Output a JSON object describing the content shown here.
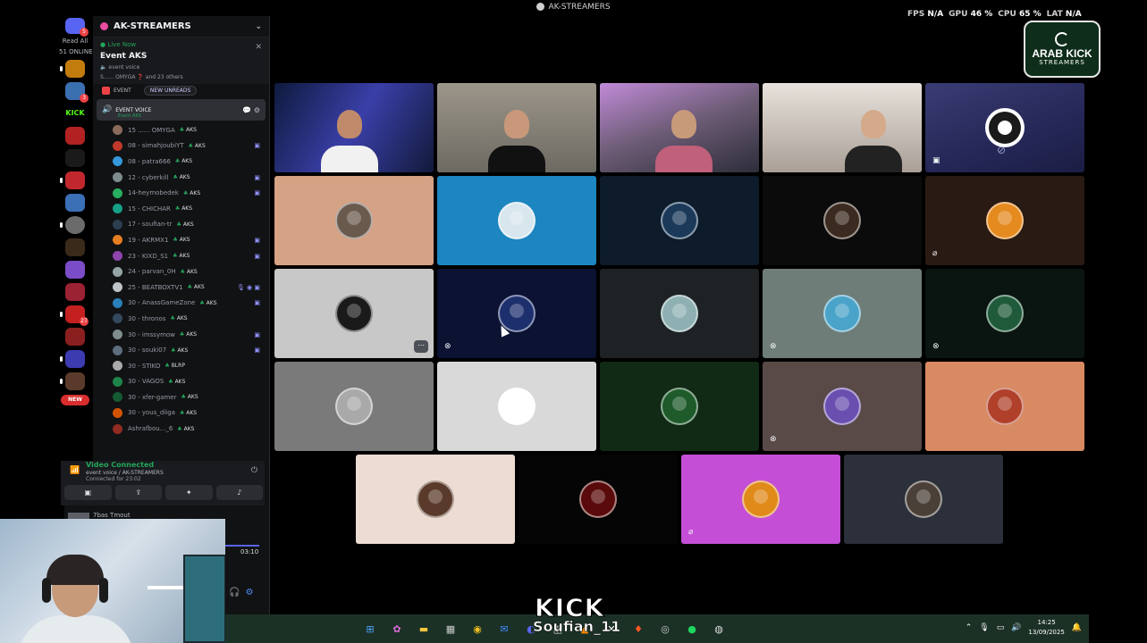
{
  "window_title": "AK-STREAMERS",
  "stats": {
    "fps_label": "FPS",
    "fps_value": "N/A",
    "gpu_label": "GPU",
    "gpu_value": "46 %",
    "cpu_label": "CPU",
    "cpu_value": "65 %",
    "lat_label": "LAT",
    "lat_value": "N/A"
  },
  "logo": {
    "line1": "ARAB KICK",
    "line2": "STREAMERS"
  },
  "rail": {
    "discord_badge": "5",
    "read_all": "Read All",
    "online": "51 ONLINE",
    "kick_label": "KICK",
    "badge_3": "3",
    "badge_27": "27",
    "new_label": "NEW"
  },
  "sidebar": {
    "server_name": "AK-STREAMERS",
    "event": {
      "live_label": "● Live Now",
      "name": "Event AKS",
      "voice": "event voice",
      "meta": "S...... OMYGA ❓ and 23 others"
    },
    "event_channel": "EVENT",
    "new_unreads": "NEW UNREADS",
    "active_channel": "EVENT VOICE",
    "active_sub": "Event AKS",
    "members": [
      {
        "name": "15 ...... OMYGA",
        "tag": "AKS",
        "color": "#8a6b5a"
      },
      {
        "name": "08 - simahjoubiYT",
        "tag": "AKS",
        "color": "#c0392b"
      },
      {
        "name": "08 - patra666",
        "tag": "AKS",
        "color": "#3498db"
      },
      {
        "name": "12 - cyberkill",
        "tag": "AKS",
        "color": "#7f8c8d"
      },
      {
        "name": "14-heymobedek",
        "tag": "AKS",
        "color": "#27ae60"
      },
      {
        "name": "15 - CHICHAR",
        "tag": "AKS",
        "color": "#16a085"
      },
      {
        "name": "17 - soufian-tr",
        "tag": "AKS",
        "color": "#2c3e50"
      },
      {
        "name": "19 - AKRMX1",
        "tag": "AKS",
        "color": "#e67e22"
      },
      {
        "name": "23 - KIXD_S1",
        "tag": "AKS",
        "color": "#8e44ad"
      },
      {
        "name": "24 - parvan_0H",
        "tag": "AKS",
        "color": "#95a5a6"
      },
      {
        "name": "25 - BEATBOXTV1",
        "tag": "AKS",
        "color": "#bdc3c7"
      },
      {
        "name": "30 - AnassGameZone",
        "tag": "AKS",
        "color": "#2980b9"
      },
      {
        "name": "30 - thronos",
        "tag": "AKS",
        "color": "#34495e"
      },
      {
        "name": "30 - imssymow",
        "tag": "AKS",
        "color": "#7f8c8d"
      },
      {
        "name": "30 - souki07",
        "tag": "AKS",
        "color": "#5d6d7e"
      },
      {
        "name": "30 - STIKO",
        "tag": "BLRP",
        "color": "#aaaaaa"
      },
      {
        "name": "30 - VAGOS",
        "tag": "AKS",
        "color": "#1e8449"
      },
      {
        "name": "30 - xfer-gamer",
        "tag": "AKS",
        "color": "#145a32"
      },
      {
        "name": "30 - yous_diiga",
        "tag": "AKS",
        "color": "#d35400"
      },
      {
        "name": "Ashrafbou..._6",
        "tag": "AKS",
        "color": "#922b21"
      }
    ],
    "voice_status": "Video Connected",
    "voice_location": "event voice / AK-STREAMERS",
    "voice_duration": "Connected for 23:02",
    "now_playing": "7bas Tmout",
    "time": "03:10"
  },
  "overlay": {
    "kick_word": "KICK",
    "streamer": "Soufian_11"
  },
  "tiles": [
    {
      "bg": "#1b2440",
      "kind": "cam1"
    },
    {
      "bg": "#8c8a82",
      "kind": "cam2",
      "speaking": true
    },
    {
      "bg": "#8f7a8f",
      "kind": "cam3",
      "speaking": true
    },
    {
      "bg": "#cfc6bf",
      "kind": "cam4"
    },
    {
      "bg": "#2d2f5f",
      "kind": "obs",
      "icon": "camera-off"
    },
    {
      "bg": "#d6a285",
      "kind": "avatar",
      "av": "#6a5a4e"
    },
    {
      "bg": "#1d86c0",
      "kind": "avatar",
      "av": "#d8e6ee"
    },
    {
      "bg": "#0d1b2a",
      "kind": "avatar",
      "av": "#1b3a5a"
    },
    {
      "bg": "#0b0b0b",
      "kind": "avatar",
      "av": "#3b2a1f"
    },
    {
      "bg": "#2a1a14",
      "kind": "avatar",
      "av": "#e58a1f",
      "icon": "mic-muted"
    },
    {
      "bg": "#c8c8c8",
      "kind": "avatar",
      "av": "#1a1a1a",
      "more": true
    },
    {
      "bg": "#0b1232",
      "kind": "avatar",
      "av": "#1e2f6e",
      "icon": "deafened"
    },
    {
      "bg": "#1e2224",
      "kind": "avatar",
      "av": "#8fb0b3"
    },
    {
      "bg": "#6f7d78",
      "kind": "avatar",
      "av": "#4aa3c8",
      "icon": "deafened"
    },
    {
      "bg": "#0a1410",
      "kind": "avatar",
      "av": "#1f5a3a",
      "icon": "deafened"
    },
    {
      "bg": "#7a7a7a",
      "kind": "avatar",
      "av": "#a9a9a9"
    },
    {
      "bg": "#d9d9d9",
      "kind": "avatar",
      "av": "#ffffff"
    },
    {
      "bg": "#102a16",
      "kind": "avatar",
      "av": "#1e5a2a"
    },
    {
      "bg": "#594a48",
      "kind": "avatar",
      "av": "#6a4fb0",
      "icon": "deafened"
    },
    {
      "bg": "#d88a62",
      "kind": "avatar",
      "av": "#b0402a"
    },
    {
      "bg": "#ecdcd2",
      "kind": "avatar",
      "av": "#5a3a2a"
    },
    {
      "bg": "#050505",
      "kind": "avatar",
      "av": "#5a0a0a"
    },
    {
      "bg": "#c44fd6",
      "kind": "avatar",
      "av": "#e08a1a",
      "icon": "mic-muted"
    },
    {
      "bg": "#2b303a",
      "kind": "avatar",
      "av": "#4a4038"
    }
  ],
  "taskbar": {
    "time": "14:25",
    "date": "13/09/2025"
  },
  "colors": {
    "speaking": "#23a55a",
    "brand": "#5865f2",
    "kick": "#53fc18"
  }
}
